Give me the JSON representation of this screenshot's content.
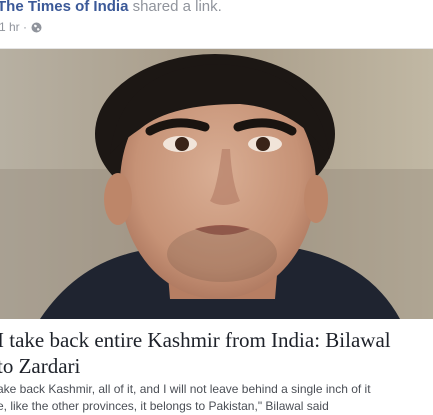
{
  "post": {
    "page_name": "The Times of India",
    "action_text": "shared a link.",
    "time_text": "1 hr ·",
    "audience_icon": "globe-icon"
  },
  "link": {
    "title": "I take back entire Kashmir from India: Bilawal\nBhutto Zardari",
    "title_visible": "I take back entire Kashmir from India: Bilawal\n to Zardari",
    "description": "ake back Kashmir, all of it, and I will not leave behind a single inch of it\ne, like the other provinces, it belongs to Pakistan,\" Bilawal said"
  },
  "colors": {
    "link_blue": "#3b5998",
    "meta_gray": "#90949c",
    "title_text": "#1d2129"
  }
}
